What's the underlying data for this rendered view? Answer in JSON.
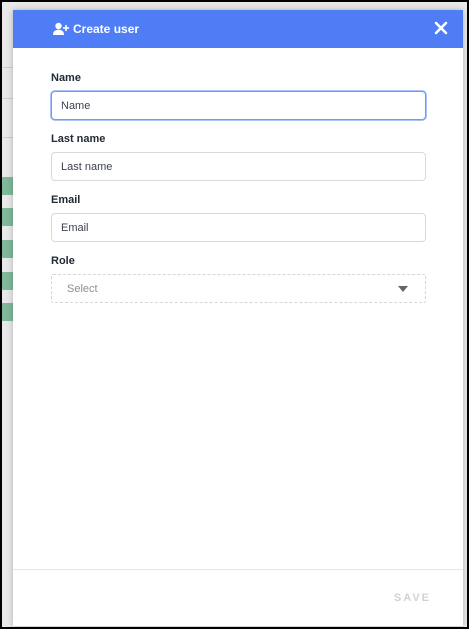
{
  "modal": {
    "title": "Create user",
    "header_icon": "user-plus-icon",
    "close_icon": "close-icon",
    "header_color": "#4f7df5"
  },
  "form": {
    "name": {
      "label": "Name",
      "placeholder": "Name",
      "value": ""
    },
    "last_name": {
      "label": "Last name",
      "placeholder": "Last name",
      "value": ""
    },
    "email": {
      "label": "Email",
      "placeholder": "Email",
      "value": ""
    },
    "role": {
      "label": "Role",
      "selected": "Select",
      "icon": "caret-down-icon"
    }
  },
  "footer": {
    "save_label": "SAVE"
  }
}
